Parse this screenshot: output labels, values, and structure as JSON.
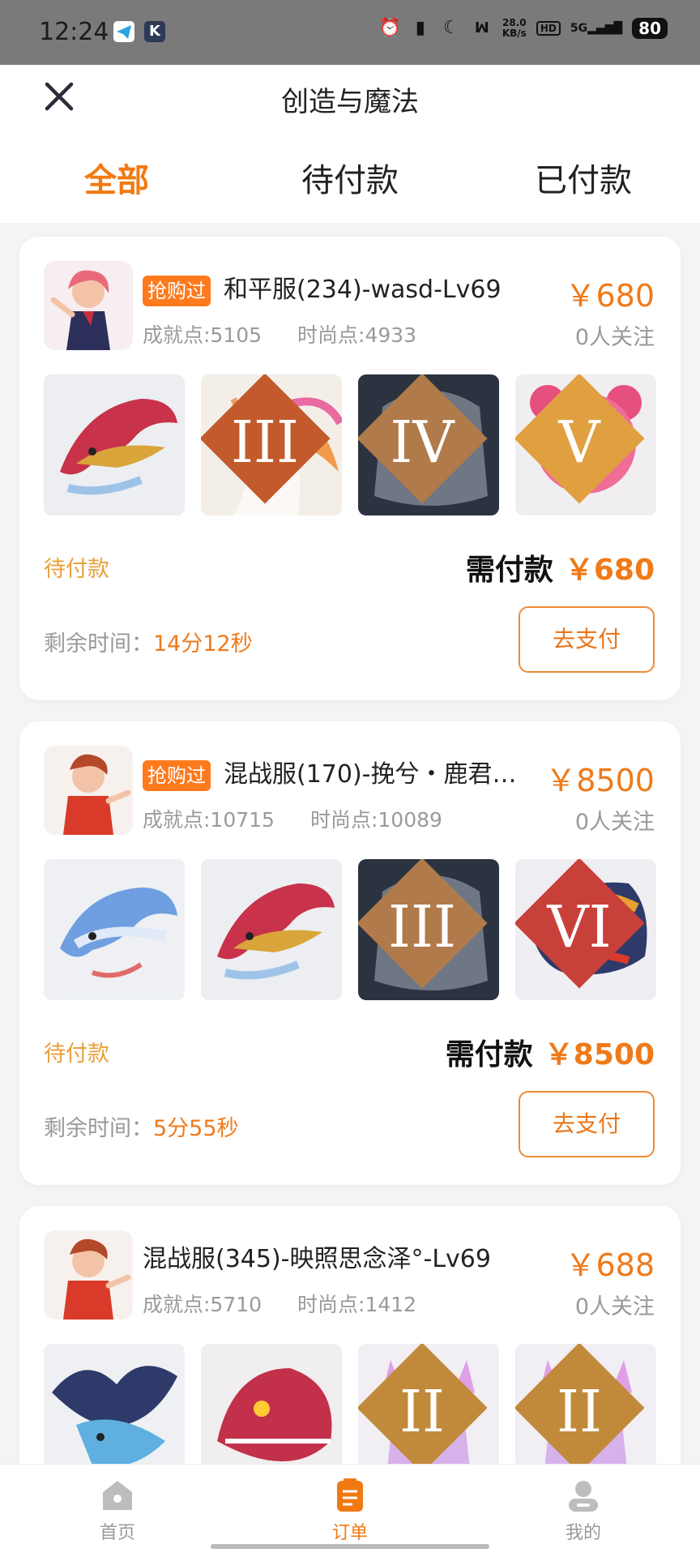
{
  "status_bar": {
    "time": "12:24",
    "net_speed": "28.0\nKB/s",
    "hd": "HD",
    "signal": "5G",
    "battery": "80"
  },
  "header": {
    "title": "创造与魔法",
    "close_icon": "close-icon"
  },
  "tabs": [
    {
      "label": "全部",
      "active": true
    },
    {
      "label": "待付款",
      "active": false
    },
    {
      "label": "已付款",
      "active": false
    }
  ],
  "orders": [
    {
      "badge": "抢购过",
      "name": "和平服(234)-wasd-Lv69",
      "achievement": "成就点:5105",
      "fashion": "时尚点:4933",
      "price": "￥680",
      "followers": "0人关注",
      "thumbs": [
        {
          "icon": "red-dragon",
          "tier": ""
        },
        {
          "icon": "white-unicorn",
          "tier": "III"
        },
        {
          "icon": "stone-golem",
          "tier": "IV"
        },
        {
          "icon": "pink-bear",
          "tier": "V"
        }
      ],
      "status": "待付款",
      "pay_label": "需付款",
      "pay_amount": "￥680",
      "remain_label": "剩余时间：",
      "remain_time": "14分12秒",
      "button": "去支付"
    },
    {
      "badge": "抢购过",
      "name": "混战服(170)-挽兮・鹿君…",
      "achievement": "成就点:10715",
      "fashion": "时尚点:10089",
      "price": "￥8500",
      "followers": "0人关注",
      "thumbs": [
        {
          "icon": "blue-dragon",
          "tier": ""
        },
        {
          "icon": "red-dragon",
          "tier": ""
        },
        {
          "icon": "stone-golem",
          "tier": "III"
        },
        {
          "icon": "fire-dragon",
          "tier": "VI"
        }
      ],
      "status": "待付款",
      "pay_label": "需付款",
      "pay_amount": "￥8500",
      "remain_label": "剩余时间：",
      "remain_time": "5分55秒",
      "button": "去支付"
    },
    {
      "badge": "",
      "name": "混战服(345)-映照思念泽°-Lv69",
      "achievement": "成就点:5710",
      "fashion": "时尚点:1412",
      "price": "￥688",
      "followers": "0人关注",
      "thumbs": [
        {
          "icon": "blue-winged-dragon",
          "tier": ""
        },
        {
          "icon": "red-lizard",
          "tier": ""
        },
        {
          "icon": "fox-girl",
          "tier": "II"
        },
        {
          "icon": "fox-girl",
          "tier": "II"
        }
      ]
    }
  ],
  "bottom_nav": [
    {
      "label": "首页",
      "icon": "home-icon",
      "active": false
    },
    {
      "label": "订单",
      "icon": "order-icon",
      "active": true
    },
    {
      "label": "我的",
      "icon": "profile-icon",
      "active": false
    }
  ],
  "colors": {
    "accent": "#ef7a1a",
    "status": "#e8a13a",
    "badge": "#ff7a1c"
  }
}
